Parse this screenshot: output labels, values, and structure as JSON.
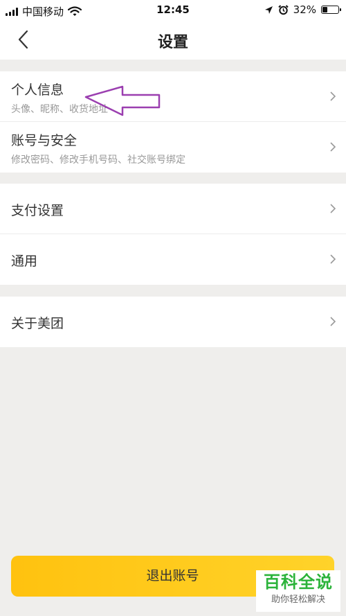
{
  "status_bar": {
    "carrier": "中国移动",
    "time": "12:45",
    "battery": "32%",
    "battery_level": 0.32,
    "icons": [
      "signal-icon",
      "wifi-icon",
      "location-icon",
      "alarm-icon",
      "battery-icon"
    ]
  },
  "nav": {
    "title": "设置",
    "back_icon": "back-arrow-icon"
  },
  "sections": {
    "account": {
      "personal_info": {
        "title": "个人信息",
        "subtitle": "头像、昵称、收货地址"
      },
      "account_security": {
        "title": "账号与安全",
        "subtitle": "修改密码、修改手机号码、社交账号绑定"
      }
    },
    "general": {
      "payment": {
        "title": "支付设置"
      },
      "common": {
        "title": "通用"
      }
    },
    "about": {
      "about_meituan": {
        "title": "关于美团"
      }
    }
  },
  "logout_label": "退出账号",
  "watermark": {
    "main": "百科全说",
    "sub": "助你轻松解决"
  },
  "colors": {
    "background": "#efeeec",
    "accent": "#ffc20f",
    "annotation_arrow": "#9b3fb0",
    "watermark_green": "#2bb33a"
  }
}
